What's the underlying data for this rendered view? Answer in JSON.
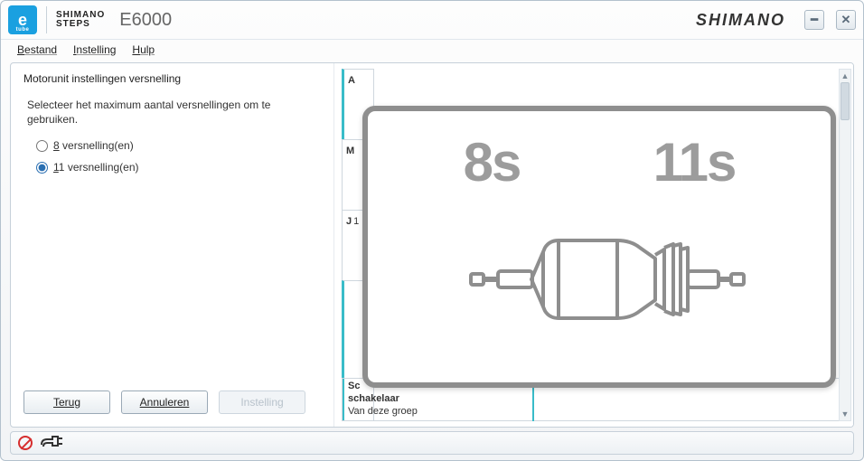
{
  "title": {
    "model": "E6000",
    "brand": "SHIMANO",
    "steps_line1": "SHIMANO",
    "steps_line2": "STEPS",
    "etube_e": "e",
    "etube_tube": "tube"
  },
  "menu": {
    "file": "Bestand",
    "settings": "Instelling",
    "help": "Hulp"
  },
  "left": {
    "heading": "Motorunit instellingen versnelling",
    "instruction": "Selecteer het maximum aantal versnellingen om te gebruiken.",
    "option8_pre": "8",
    "option8_post": " versnelling(en)",
    "option11_pre": "1",
    "option11_mid": "1",
    "option11_post": " versnelling(en)",
    "selected": "11",
    "buttons": {
      "back": "Terug",
      "cancel": "Annuleren",
      "apply": "Instelling"
    }
  },
  "right": {
    "row_a": "A",
    "row_m": "M",
    "row_j": "J",
    "row_j_sub": "1",
    "lower_label1": "Sc",
    "lower_label2": "schakelaar",
    "lower_value": "Van deze groep"
  },
  "overlay": {
    "left_num": "8s",
    "right_num": "11s"
  }
}
